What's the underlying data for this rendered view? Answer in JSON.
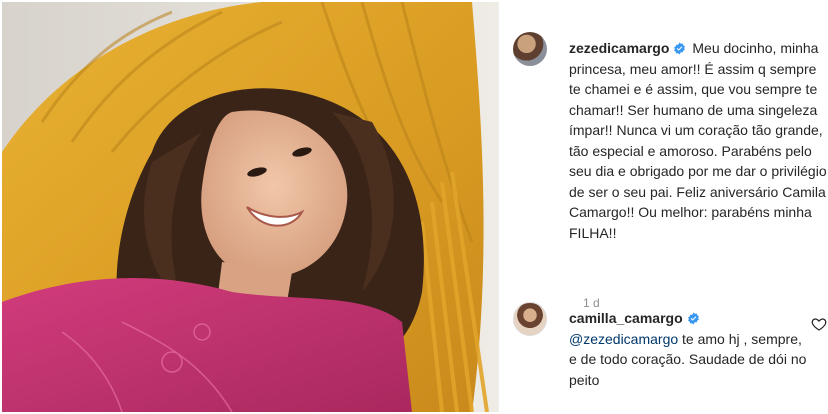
{
  "post": {
    "username": "zezedicamargo",
    "verified_icon": "verified-badge-icon",
    "caption": "Meu docinho, minha princesa, meu amor!! É assim q sempre te chamei e é assim, que vou sempre te chamar!! Ser humano de uma singeleza ímpar!! Nunca vi um coração tão grande, tão especial e amoroso. Parabéns pelo seu dia e obrigado por me dar o privilégio de ser o seu pai. Feliz aniversário Camila Camargo!! Ou melhor: parabéns minha FILHA!!",
    "timestamp": "1 d"
  },
  "comment": {
    "username": "camilla_camargo",
    "verified_icon": "verified-badge-icon",
    "mention": "@zezedicamargo",
    "text": "te amo hj , sempre, e de todo coração. Saudade de dói no peito",
    "like_icon": "heart-outline-icon"
  },
  "colors": {
    "verified_blue": "#3897f0",
    "mention_blue": "#00376b",
    "text": "#262626",
    "muted": "#8e8e8e",
    "hammock_yellow": "#e0a527",
    "blouse_pink": "#c2326e"
  }
}
